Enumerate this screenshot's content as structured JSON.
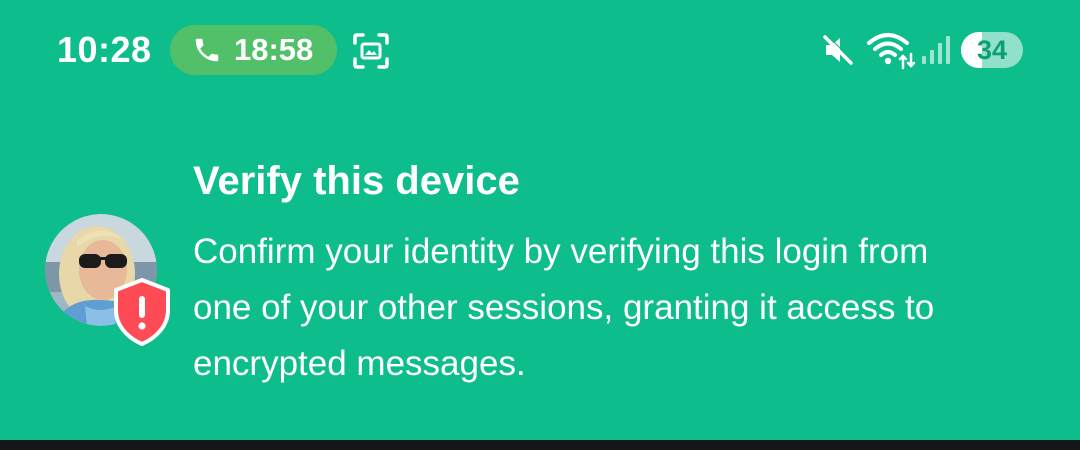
{
  "status_bar": {
    "time": "10:28",
    "call_duration": "18:58",
    "battery_level": "34",
    "icons": [
      "phone-icon",
      "screenshot-icon",
      "mute-icon",
      "wifi-icon",
      "signal-icon",
      "battery-icon"
    ]
  },
  "banner": {
    "title": "Verify this device",
    "message": "Confirm your identity by verifying this login from one of your other sessions, granting it access to encrypted messages.",
    "avatar_icon": "user-avatar",
    "badge_icon": "shield-warning-icon"
  },
  "colors": {
    "background": "#0dbd8b",
    "call_pill": "#52c069",
    "warning": "#ff4b55",
    "text": "#ffffff"
  }
}
